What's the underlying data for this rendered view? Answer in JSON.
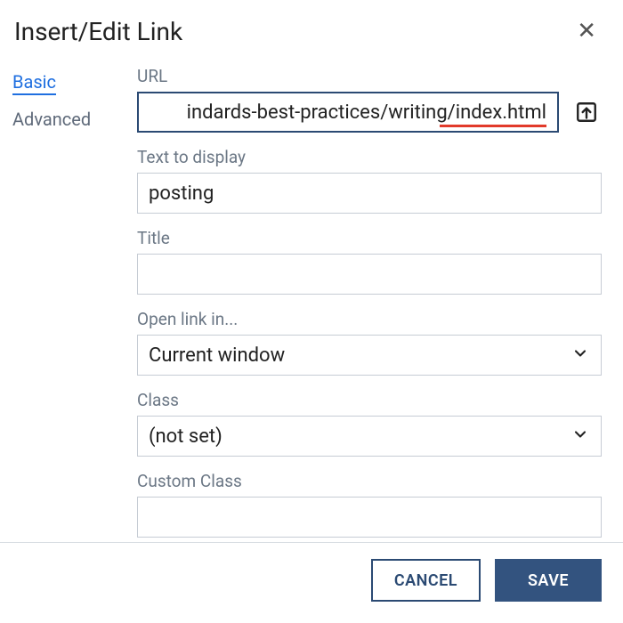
{
  "header": {
    "title": "Insert/Edit Link"
  },
  "sidebar": {
    "tabs": [
      {
        "label": "Basic",
        "active": true
      },
      {
        "label": "Advanced",
        "active": false
      }
    ]
  },
  "form": {
    "url": {
      "label": "URL",
      "value": "indards-best-practices/writing/index.html"
    },
    "text_to_display": {
      "label": "Text to display",
      "value": "posting"
    },
    "title": {
      "label": "Title",
      "value": ""
    },
    "open_link_in": {
      "label": "Open link in...",
      "value": "Current window"
    },
    "class": {
      "label": "Class",
      "value": "(not set)"
    },
    "custom_class": {
      "label": "Custom Class",
      "value": ""
    }
  },
  "footer": {
    "cancel": "CANCEL",
    "save": "SAVE"
  },
  "icons": {
    "close": "✕"
  }
}
